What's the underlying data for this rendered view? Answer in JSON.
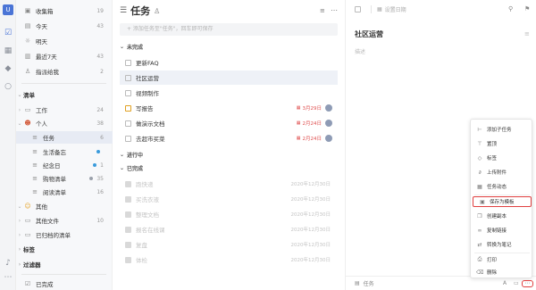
{
  "rail": {
    "avatar": "U"
  },
  "sidebar": {
    "top": [
      {
        "label": "收集箱",
        "count": "19"
      },
      {
        "label": "今天",
        "count": "43"
      },
      {
        "label": "明天",
        "count": ""
      },
      {
        "label": "最近7天",
        "count": "43"
      },
      {
        "label": "指派给我",
        "count": "2"
      }
    ],
    "lists_header": "清单",
    "lists": [
      {
        "label": "工作",
        "count": "24",
        "level": 1
      },
      {
        "label": "个人",
        "count": "38",
        "level": 1
      },
      {
        "label": "任务",
        "count": "6",
        "level": 2,
        "selected": true
      },
      {
        "label": "生活备忘",
        "count": "",
        "level": 2,
        "dot": "#3a9bdc"
      },
      {
        "label": "纪念日",
        "count": "1",
        "level": 2,
        "dot": "#3a9bdc"
      },
      {
        "label": "购物清单",
        "count": "35",
        "level": 2,
        "dot": "#9aa0aa"
      },
      {
        "label": "阅读清单",
        "count": "16",
        "level": 2
      },
      {
        "label": "其他",
        "count": "",
        "level": 0
      },
      {
        "label": "其他文件",
        "count": "10",
        "level": 1
      },
      {
        "label": "已归档的清单",
        "count": "",
        "level": 1
      }
    ],
    "tags_header": "标签",
    "filters_header": "过滤器",
    "completed": "已完成"
  },
  "middle": {
    "title": "任务",
    "add_placeholder": "+ 添加任务至\"任务\"，回车即可保存",
    "groups": {
      "open": "未完成",
      "progress": "进行中",
      "done": "已完成"
    },
    "open_tasks": [
      {
        "title": "更新FAQ",
        "due": "",
        "flag": false
      },
      {
        "title": "社区运营",
        "due": "",
        "flag": false,
        "selected": true
      },
      {
        "title": "视频制作",
        "due": "",
        "flag": false
      },
      {
        "title": "写报告",
        "due": "3月29日",
        "flag": true
      },
      {
        "title": "做演示文档",
        "due": "2月24日",
        "flag": false
      },
      {
        "title": "去超市买菜",
        "due": "2月24日",
        "flag": false
      }
    ],
    "done_tasks": [
      {
        "title": "跑快递",
        "date": "2020年12月30日"
      },
      {
        "title": "买洗衣液",
        "date": "2020年12月30日"
      },
      {
        "title": "整理文档",
        "date": "2020年12月30日"
      },
      {
        "title": "报名在线课",
        "date": "2020年12月30日"
      },
      {
        "title": "复盘",
        "date": "2020年12月30日"
      },
      {
        "title": "体检",
        "date": "2020年12月30日"
      }
    ]
  },
  "right": {
    "set_date": "设置日期",
    "task_title": "社区运营",
    "desc_placeholder": "描述",
    "list_name": "任务"
  },
  "menu": {
    "items": [
      {
        "label": "添加子任务",
        "icon": "subtask-icon"
      },
      {
        "label": "置顶",
        "icon": "pin-icon"
      },
      {
        "label": "标签",
        "icon": "tag-icon"
      },
      {
        "label": "上传附件",
        "icon": "attachment-icon"
      },
      {
        "label": "任务动态",
        "icon": "activity-icon"
      },
      {
        "label": "保存为模板",
        "icon": "template-icon",
        "highlight": true
      },
      {
        "label": "创建副本",
        "icon": "copy-icon"
      },
      {
        "label": "复制链接",
        "icon": "link-icon"
      },
      {
        "label": "转换为笔记",
        "icon": "note-icon"
      },
      {
        "label": "打印",
        "icon": "print-icon"
      },
      {
        "label": "删除",
        "icon": "trash-icon"
      }
    ]
  },
  "colors": {
    "accent": "#4a74d6",
    "highlight": "#e04040",
    "due": "#e05050"
  }
}
